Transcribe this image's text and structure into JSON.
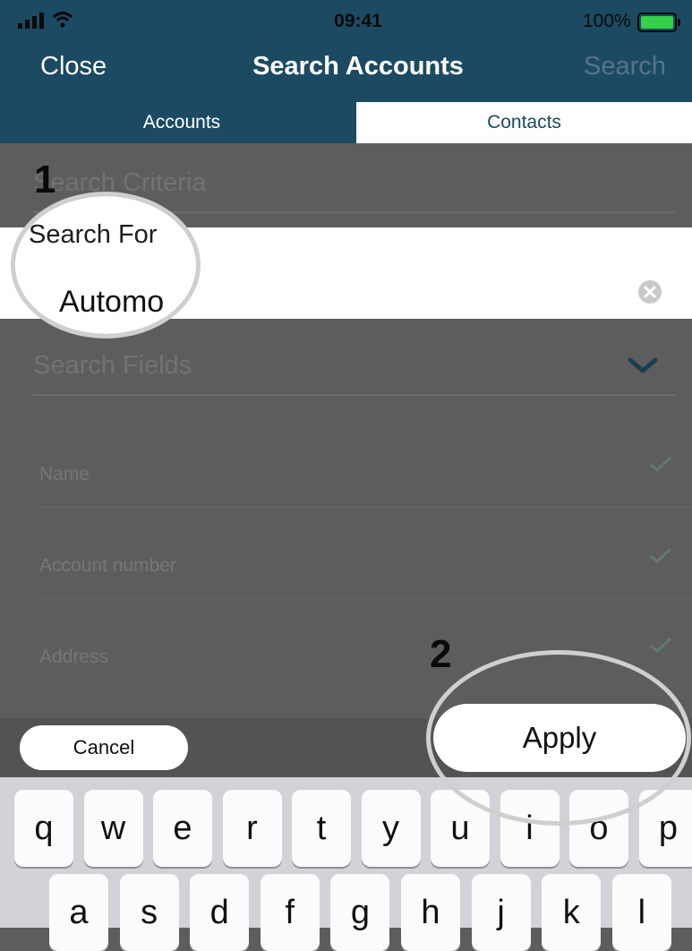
{
  "status_bar": {
    "time": "09:41",
    "battery_percent": "100%"
  },
  "nav": {
    "close_label": "Close",
    "title": "Search Accounts",
    "search_label": "Search"
  },
  "tabs": [
    {
      "label": "Accounts"
    },
    {
      "label": "Contacts"
    }
  ],
  "form": {
    "criteria_heading": "Search Criteria",
    "search_for_label": "Search For",
    "search_for_value": "Automo",
    "search_fields_heading": "Search Fields",
    "fields": [
      {
        "label": "Name",
        "checked": true
      },
      {
        "label": "Account number",
        "checked": true
      },
      {
        "label": "Address",
        "checked": true
      }
    ]
  },
  "actions": {
    "cancel_label": "Cancel",
    "apply_label": "Apply"
  },
  "keyboard": {
    "row1": [
      "q",
      "w",
      "e",
      "r",
      "t",
      "y",
      "u",
      "i",
      "o",
      "p"
    ],
    "row2": [
      "a",
      "s",
      "d",
      "f",
      "g",
      "h",
      "j",
      "k",
      "l"
    ]
  },
  "callouts": {
    "one": "1",
    "two": "2"
  },
  "colors": {
    "nav_bg": "#1c4a62",
    "overlay": "#5d5d5d",
    "accent_check": "#4a6a5a"
  }
}
